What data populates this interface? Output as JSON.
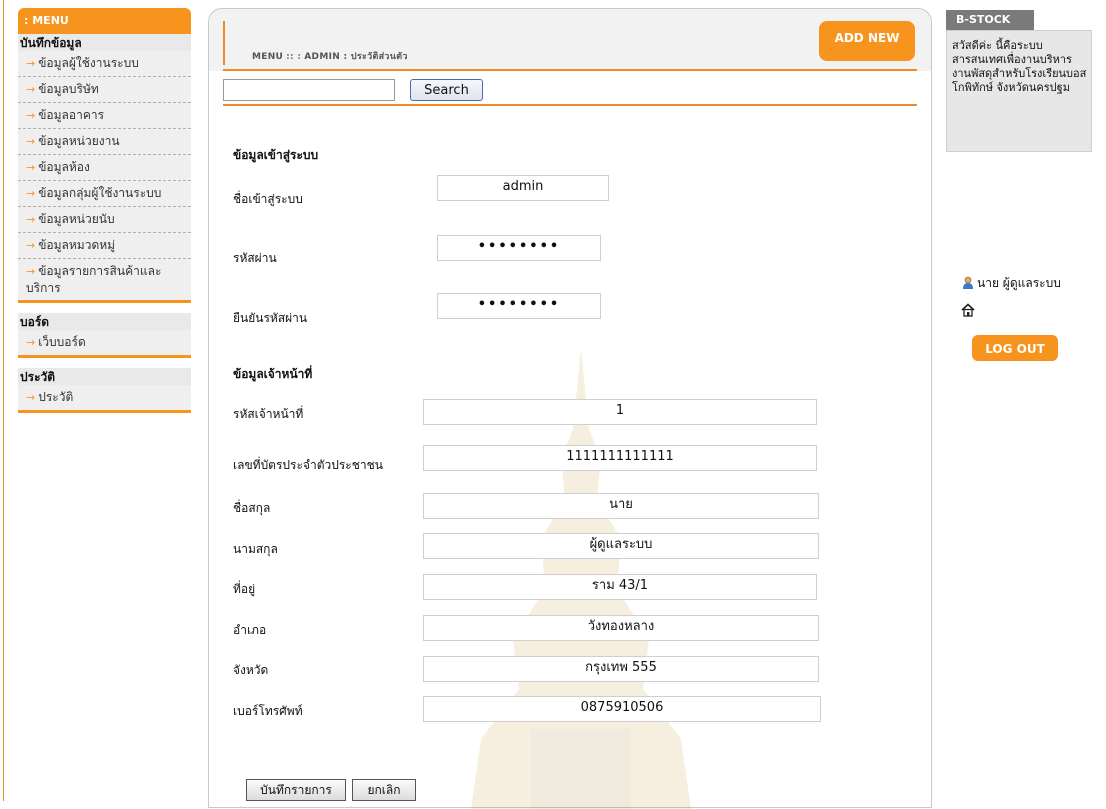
{
  "menu": {
    "header": ": MENU",
    "groups": [
      {
        "title": "บันทึกข้อมูล",
        "items": [
          "ข้อมูลผู้ใช้งานระบบ",
          "ข้อมูลบริษัท",
          "ข้อมูลอาคาร",
          "ข้อมูลหน่วยงาน",
          "ข้อมูลห้อง",
          "ข้อมูลกลุ่มผู้ใช้งานระบบ",
          "ข้อมูลหน่วยนับ",
          "ข้อมูลหมวดหมู่",
          "ข้อมูลรายการสินค้าและบริการ"
        ]
      },
      {
        "title": "บอร์ด",
        "items": [
          "เว็บบอร์ด"
        ]
      },
      {
        "title": "ประวัติ",
        "items": [
          "ประวัติ"
        ]
      }
    ]
  },
  "header": {
    "breadcrumb_menu": "MENU",
    "breadcrumb_sep": ":: :",
    "breadcrumb_admin": "ADMIN",
    "breadcrumb_page": ": ประวัติส่วนตัว",
    "add_new": "ADD NEW"
  },
  "search": {
    "value": "",
    "button": "Search"
  },
  "login_section": {
    "title": "ข้อมูลเข้าสู่ระบบ",
    "username_label": "ชื่อเข้าสู่ระบบ",
    "username_value": "admin",
    "password_label": "รหัสผ่าน",
    "password_value": "••••••••",
    "confirm_label": "ยืนยันรหัสผ่าน",
    "confirm_value": "••••••••"
  },
  "staff_section": {
    "title": "ข้อมูลเจ้าหน้าที่",
    "fields": [
      {
        "label": "รหัสเจ้าหน้าที่",
        "value": "1"
      },
      {
        "label": "เลขที่บัตรประจำตัวประชาชน",
        "value": "1111111111111"
      },
      {
        "label": "ชื่อสกุล",
        "value": "นาย"
      },
      {
        "label": "นามสกุล",
        "value": "ผู้ดูแลระบบ"
      },
      {
        "label": "ที่อยู่",
        "value": "ราม 43/1"
      },
      {
        "label": "อำเภอ",
        "value": "วังทองหลาง"
      },
      {
        "label": "จังหวัด",
        "value": "กรุงเทพ 555"
      },
      {
        "label": "เบอร์โทรศัพท์",
        "value": "0875910506"
      }
    ]
  },
  "actions": {
    "save": "บันทึกรายการ",
    "cancel": "ยกเลิก"
  },
  "sidebar_right": {
    "brand": "B-STOCK",
    "welcome": "สวัสดีค่ะ นี้คือระบบสารสนเทศเพื่องานบริหารงานพัสดุสำหรับโรงเรียนบอสโกพิทักษ์ จังหวัดนครปฐม",
    "user": "นาย ผู้ดูแลระบบ",
    "logout": "LOG OUT"
  },
  "colors": {
    "accent": "#f7941d",
    "line": "#f08a24",
    "brand_head": "#7a7a7a"
  },
  "icons": {
    "menu_item": "arrow-right-icon",
    "user": "user-icon",
    "home": "home-icon"
  }
}
